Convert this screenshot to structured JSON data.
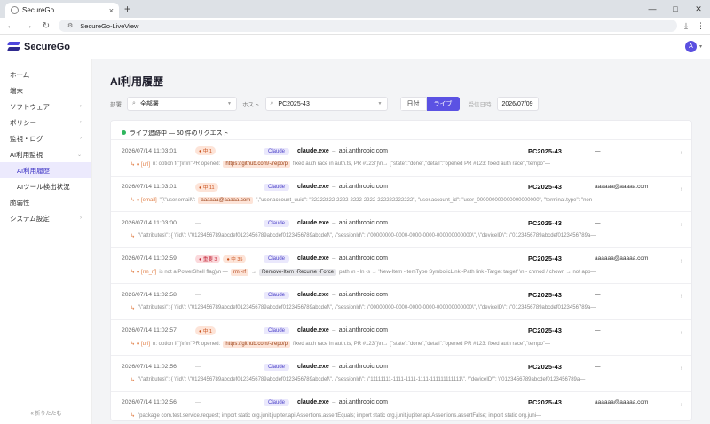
{
  "browser": {
    "tab_title": "SecureGo",
    "tab_close": "×",
    "new_tab": "+",
    "win_min": "—",
    "win_max": "□",
    "win_close": "✕",
    "back": "←",
    "forward": "→",
    "reload": "↻",
    "url": "SecureGo-LiveView",
    "download_icon": "⤓",
    "menu_icon": "⋮"
  },
  "app": {
    "brand": "SecureGo",
    "user_initial": "A"
  },
  "sidebar": {
    "items": [
      {
        "label": "ホーム",
        "arrow": ""
      },
      {
        "label": "端末",
        "arrow": ""
      },
      {
        "label": "ソフトウェア",
        "arrow": "›"
      },
      {
        "label": "ポリシー",
        "arrow": "›"
      },
      {
        "label": "監視・ログ",
        "arrow": "›"
      },
      {
        "label": "AI利用監視",
        "arrow": "⌄"
      },
      {
        "label": "AI利用履歴",
        "arrow": ""
      },
      {
        "label": "AIツール検出状況",
        "arrow": ""
      },
      {
        "label": "脆弱性",
        "arrow": ""
      },
      {
        "label": "システム設定",
        "arrow": "›"
      }
    ],
    "collapse": "« 折りたたむ"
  },
  "main": {
    "title": "AI利用履歴",
    "filters": {
      "dept_label": "部署",
      "dept_value": "全部署",
      "host_label": "ホスト",
      "host_value": "PC2025-43",
      "mode_date": "日付",
      "mode_live": "ライブ",
      "date_label": "受信日時",
      "date_value": "2026/07/09"
    },
    "status": "ライブ追跡中 — 60 件のリクエスト",
    "rows": [
      {
        "time": "2026/07/14 11:03:01",
        "b1": "● 中 1",
        "b2": "",
        "tool": "Claude",
        "proc": "claude.exe",
        "dest": "→ api.anthropic.com",
        "host": "PC2025-43",
        "mail": "—",
        "pre": "↳ ● [url] ",
        "seg1": "n: option f(\")\\n\\n\"PR opened:",
        "link": "https://github.com/-/repo/p",
        "seg2": "fixed auth race in auth.ts, PR #123\"}\\n→ {\"state\":\"done\",\"detail\":\"opened PR #123: fixed auth race\",\"tempo\"—"
      },
      {
        "time": "2026/07/14 11:03:01",
        "b1": "● 中 11",
        "b2": "",
        "tool": "Claude",
        "proc": "claude.exe",
        "dest": "→ api.anthropic.com",
        "host": "PC2025-43",
        "mail": "aaaaaa@aaaaa.com",
        "pre": "↳ ● [email] ",
        "seg1": "\"{\\\"user.email\\\":",
        "link": "aaaaaa@aaaaa.com",
        "seg2": "\",\"user.account_uuid\": \"22222222-2222-2222-2222-222222222222\", \"user.account_id\": \"user_000000000000000000000\", \"terminal.type\": \"non—"
      },
      {
        "time": "2026/07/14 11:03:00",
        "b1": "",
        "b2": "",
        "tool": "Claude",
        "proc": "claude.exe",
        "dest": "→ api.anthropic.com",
        "host": "PC2025-43",
        "mail": "—",
        "pre": "↳ ",
        "seg1": "\"\\\"attributes\\\": { \\\"id\\\": \\\"0123456789abcdef0123456789abcdef0123456789abcdef\\\", \\\"sessionId\\\": \\\"00000000-0000-0000-0000-000000000000\\\", \\\"deviceID\\\": \\\"0123456789abcdef0123456789a—",
        "link": "",
        "seg2": ""
      },
      {
        "time": "2026/07/14 11:02:59",
        "b1": "● 重要 3",
        "b2": "● 中 35",
        "tool": "Claude",
        "proc": "claude.exe",
        "dest": "→ api.anthropic.com",
        "host": "PC2025-43",
        "mail": "aaaaaa@aaaaa.com",
        "pre": "↳ ● [rm_rf] ",
        "seg1": "is not a PowerShell flag)\\n —",
        "cmd1": "rm -rf",
        "cmd2": "Remove-Item -Recurse -Force",
        "seg2": "path \\n - ln -s → 'New-Item -ItemType SymbolicLink -Path link -Target target' \\n - chmod / chown → not app—"
      },
      {
        "time": "2026/07/14 11:02:58",
        "b1": "",
        "b2": "",
        "tool": "Claude",
        "proc": "claude.exe",
        "dest": "→ api.anthropic.com",
        "host": "PC2025-43",
        "mail": "—",
        "pre": "↳ ",
        "seg1": "\"\\\"attributes\\\": { \\\"id\\\": \\\"0123456789abcdef0123456789abcdef0123456789abcdef\\\", \\\"sessionId\\\": \\\"00000000-0000-0000-0000-000000000000\\\", \\\"deviceID\\\": \\\"0123456789abcdef0123456789a—",
        "link": "",
        "seg2": ""
      },
      {
        "time": "2026/07/14 11:02:57",
        "b1": "● 中 1",
        "b2": "",
        "tool": "Claude",
        "proc": "claude.exe",
        "dest": "→ api.anthropic.com",
        "host": "PC2025-43",
        "mail": "—",
        "pre": "↳ ● [url] ",
        "seg1": "n: option f(\")\\n\\n\"PR opened:",
        "link": "https://github.com/-/repo/p",
        "seg2": "fixed auth race in auth.ts, PR #123\"}\\n→ {\"state\":\"done\",\"detail\":\"opened PR #123: fixed auth race\",\"tempo\"—"
      },
      {
        "time": "2026/07/14 11:02:56",
        "b1": "",
        "b2": "",
        "tool": "Claude",
        "proc": "claude.exe",
        "dest": "→ api.anthropic.com",
        "host": "PC2025-43",
        "mail": "—",
        "pre": "↳ ",
        "seg1": "\"\\\"attributes\\\": { \\\"id\\\": \\\"0123456789abcdef0123456789abcdef0123456789abcdef\\\", \\\"sessionId\\\": \\\"11111111-1111-1111-1111-111111111111\\\", \\\"deviceID\\\": \\\"0123456789abcdef0123456789a—",
        "link": "",
        "seg2": ""
      },
      {
        "time": "2026/07/14 11:02:56",
        "b1": "",
        "b2": "",
        "tool": "Claude",
        "proc": "claude.exe",
        "dest": "→ api.anthropic.com",
        "host": "PC2025-43",
        "mail": "aaaaaa@aaaaa.com",
        "pre": "↳ ",
        "seg1": "\"package com.test.service.request; import static org.junit.jupiter.api.Assertions.assertEquals; import static org.junit.jupiter.api.Assertions.assertFalse; import static org.juni—",
        "link": "",
        "seg2": ""
      }
    ]
  },
  "colors": {
    "accent": "#5b52e3",
    "live_dot": "#2fb65e"
  }
}
